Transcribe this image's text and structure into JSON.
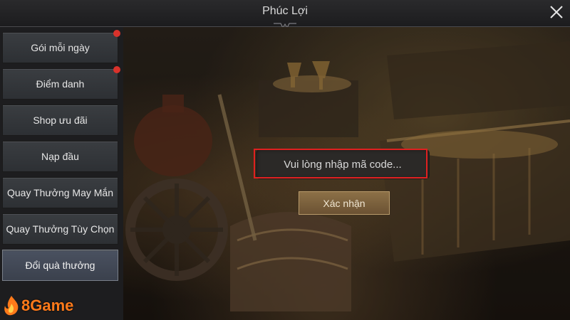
{
  "window": {
    "title": "Phúc Lợi"
  },
  "sidebar": {
    "items": [
      {
        "label": "Gói mỗi ngày",
        "notification": true
      },
      {
        "label": "Điểm danh",
        "notification": true
      },
      {
        "label": "Shop ưu đãi",
        "notification": false
      },
      {
        "label": "Nạp đầu",
        "notification": false
      },
      {
        "label": "Quay Thưởng May Mắn",
        "notification": false
      },
      {
        "label": "Quay Thưởng Tùy Chọn",
        "notification": false
      },
      {
        "label": "Đổi quà thưởng",
        "notification": false,
        "active": true
      }
    ]
  },
  "redeem": {
    "placeholder": "Vui lòng nhập mã code...",
    "value": "",
    "confirm_label": "Xác nhận"
  },
  "watermark": {
    "text": "8Game"
  },
  "colors": {
    "highlight": "#e02020",
    "notification_dot": "#d9322b",
    "confirm_button": "#8c7047",
    "logo": "#ff7a1a"
  },
  "icons": {
    "close": "close-icon",
    "logo": "flame-logo-icon"
  }
}
